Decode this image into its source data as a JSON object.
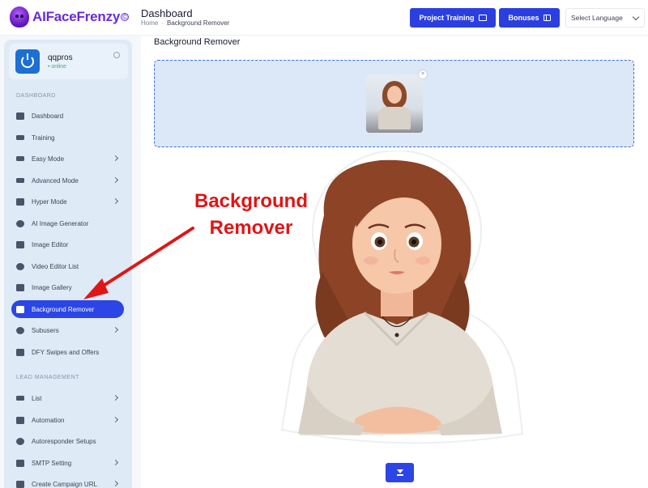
{
  "header": {
    "brand": "AIFaceFrenzy",
    "brand_badge": "©",
    "title": "Dashboard",
    "breadcrumb": {
      "home": "Home",
      "separator": "-",
      "current": "Background Remover"
    },
    "project_training_label": "Project Training",
    "bonuses_label": "Bonuses",
    "language_label": "Select Language"
  },
  "user": {
    "name": "qqpros",
    "status": "• online"
  },
  "sidebar": {
    "dashboard_section": "DASHBOARD",
    "lead_section": "LEAD MANAGEMENT",
    "items": [
      {
        "label": "Dashboard",
        "icon": "grid-icon"
      },
      {
        "label": "Training",
        "icon": "card-icon"
      },
      {
        "label": "Easy Mode",
        "icon": "list-icon"
      },
      {
        "label": "Advanced Mode",
        "icon": "table-icon"
      },
      {
        "label": "Hyper Mode",
        "icon": "monitor-icon"
      },
      {
        "label": "AI Image Generator",
        "icon": "marker-icon"
      },
      {
        "label": "Image Editor",
        "icon": "image-icon"
      },
      {
        "label": "Video Editor List",
        "icon": "video-icon"
      },
      {
        "label": "Image Gallery",
        "icon": "gallery-icon"
      },
      {
        "label": "Background Remover",
        "icon": "eraser-icon"
      },
      {
        "label": "Subusers",
        "icon": "users-icon"
      },
      {
        "label": "DFY Swipes and Offers",
        "icon": "swipe-icon"
      },
      {
        "label": "List",
        "icon": "list-icon"
      },
      {
        "label": "Automation",
        "icon": "mail-icon"
      },
      {
        "label": "Autoresponder Setups",
        "icon": "gear-icon"
      },
      {
        "label": "SMTP Setting",
        "icon": "send-icon"
      },
      {
        "label": "Create Campaign URL",
        "icon": "link-icon"
      }
    ]
  },
  "main": {
    "title": "Background Remover",
    "callout_line1": "Background",
    "callout_line2": "Remover"
  },
  "colors": {
    "primary": "#2b45e6",
    "callout": "#e01616",
    "dropzone": "#dce8f8"
  }
}
